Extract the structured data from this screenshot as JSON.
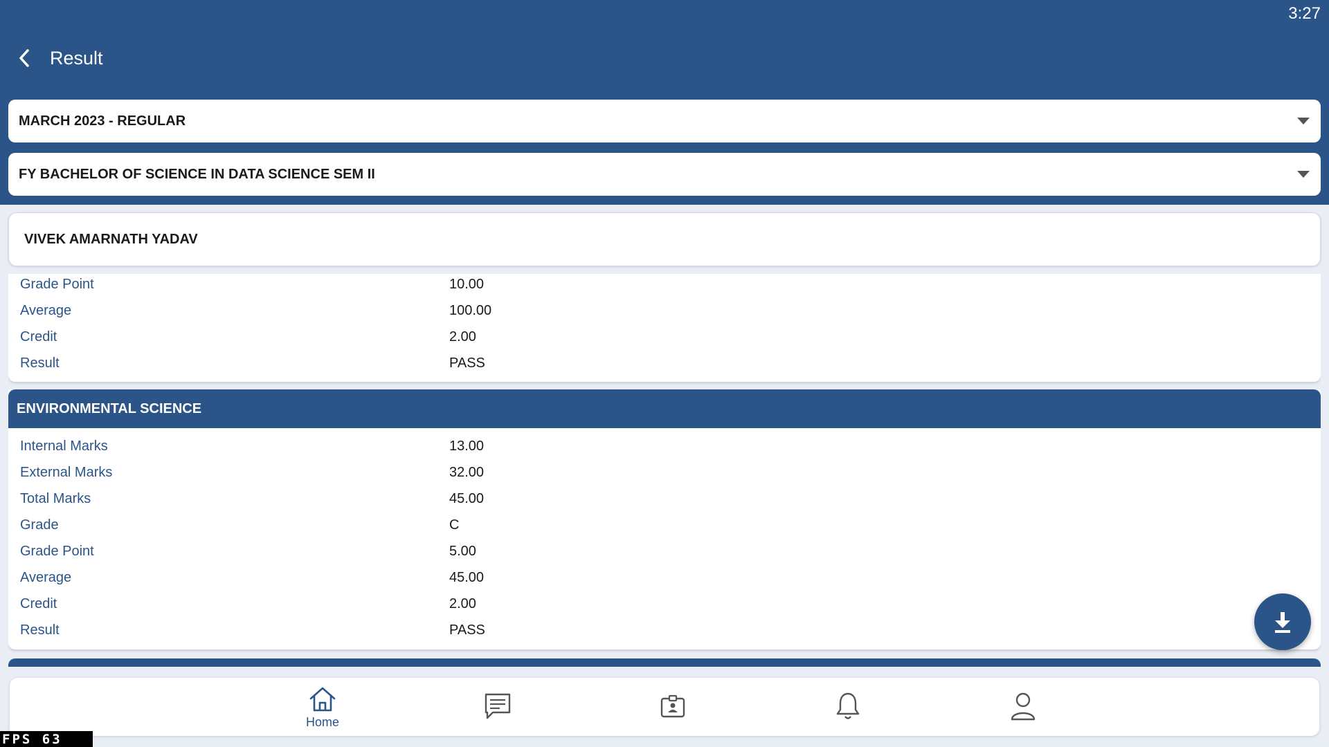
{
  "status_bar": {
    "time": "3:27"
  },
  "header": {
    "title": "Result"
  },
  "exam_select": {
    "value": "MARCH 2023 - REGULAR"
  },
  "course_select": {
    "value": "FY BACHELOR OF SCIENCE IN DATA SCIENCE SEM II"
  },
  "student": {
    "name": "VIVEK AMARNATH YADAV"
  },
  "subjects": [
    {
      "name": "",
      "rows": [
        {
          "label": "Grade Point",
          "value": "10.00"
        },
        {
          "label": "Average",
          "value": "100.00"
        },
        {
          "label": "Credit",
          "value": "2.00"
        },
        {
          "label": "Result",
          "value": "PASS"
        }
      ]
    },
    {
      "name": "ENVIRONMENTAL SCIENCE",
      "rows": [
        {
          "label": "Internal Marks",
          "value": "13.00"
        },
        {
          "label": "External Marks",
          "value": "32.00"
        },
        {
          "label": "Total Marks",
          "value": "45.00"
        },
        {
          "label": "Grade",
          "value": "C"
        },
        {
          "label": "Grade Point",
          "value": "5.00"
        },
        {
          "label": "Average",
          "value": "45.00"
        },
        {
          "label": "Credit",
          "value": "2.00"
        },
        {
          "label": "Result",
          "value": "PASS"
        }
      ]
    }
  ],
  "fab": {
    "icon": "download-icon"
  },
  "bottom_nav": {
    "items": [
      {
        "icon": "home-icon",
        "label": "Home",
        "active": true
      },
      {
        "icon": "chat-icon",
        "label": "",
        "active": false
      },
      {
        "icon": "id-card-icon",
        "label": "",
        "active": false
      },
      {
        "icon": "bell-icon",
        "label": "",
        "active": false
      },
      {
        "icon": "profile-icon",
        "label": "",
        "active": false
      }
    ]
  },
  "debug_overlay": {
    "text": "FPS 63"
  },
  "colors": {
    "primary": "#2b5589",
    "background": "#e9eef4",
    "card": "#ffffff"
  }
}
